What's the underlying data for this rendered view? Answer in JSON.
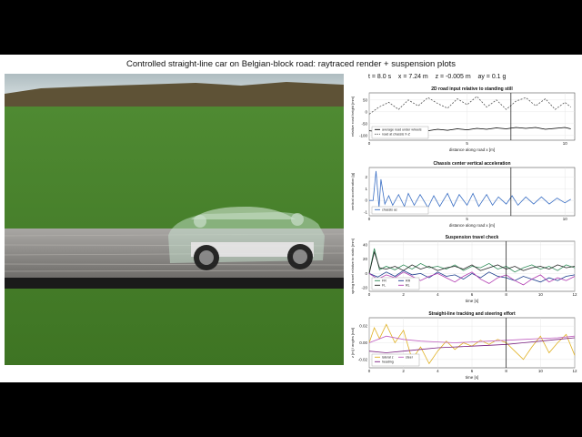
{
  "title": "Controlled straight-line car on Belgian-block road: raytraced render + suspension plots",
  "status": {
    "t": "t = 8.0 s",
    "x": "x = 7.24 m",
    "z": "z = -0.005 m",
    "ay": "ay = 0.1 g"
  },
  "colors": {
    "grass": "#3f7f24",
    "road": "#8a8a8a",
    "sky_top": "#c9d6d9",
    "car_body": "#b7d6c2"
  },
  "chart_data": [
    {
      "type": "line",
      "title": "2D road input relative to standing still",
      "xlabel": "distance along road x [m]",
      "ylabel": "relative road height [mm]",
      "xticks": [
        "0",
        "5",
        "10"
      ],
      "yticks": [
        "50",
        "0",
        "-50",
        "-100"
      ],
      "xlim": [
        0,
        10.5
      ],
      "ylim": [
        -120,
        80
      ],
      "legend_position": "bottom-left",
      "cursor_x": 7.24,
      "series": [
        {
          "name": "average road under wheels",
          "color": "#000000",
          "style": "solid",
          "x": [
            0,
            0.5,
            1,
            1.5,
            2,
            2.5,
            3,
            3.5,
            4,
            4.5,
            5,
            5.5,
            6,
            6.5,
            7,
            7.5,
            8,
            8.5,
            9,
            9.5,
            10,
            10.3
          ],
          "y": [
            -80,
            -84,
            -82,
            -78,
            -82,
            -76,
            -80,
            -74,
            -78,
            -72,
            -76,
            -70,
            -74,
            -68,
            -72,
            -66,
            -70,
            -66,
            -74,
            -70,
            -66,
            -72
          ]
        },
        {
          "name": "road at chassis X-Z",
          "color": "#555555",
          "style": "dashed",
          "x": [
            0,
            0.5,
            1,
            1.5,
            2,
            2.5,
            3,
            3.5,
            4,
            4.5,
            5,
            5.5,
            6,
            6.5,
            7,
            7.5,
            8,
            8.5,
            9,
            9.5,
            10,
            10.3
          ],
          "y": [
            -10,
            20,
            40,
            10,
            50,
            25,
            60,
            35,
            15,
            55,
            30,
            65,
            20,
            50,
            10,
            45,
            60,
            25,
            55,
            10,
            40,
            20
          ]
        }
      ]
    },
    {
      "type": "line",
      "title": "Chassis center vertical acceleration",
      "xlabel": "distance along road x [m]",
      "ylabel": "vertical acceleration [g]",
      "xticks": [
        "0",
        "5",
        "10"
      ],
      "yticks": [
        "2",
        "1",
        "0",
        "-1"
      ],
      "xlim": [
        0,
        10.5
      ],
      "ylim": [
        -1.3,
        2.8
      ],
      "legend_position": "bottom-left",
      "cursor_x": 7.24,
      "series": [
        {
          "name": "chassis az",
          "color": "#3a6fc4",
          "style": "solid",
          "x": [
            0,
            0.2,
            0.35,
            0.5,
            0.6,
            0.8,
            1,
            1.2,
            1.5,
            1.8,
            2,
            2.3,
            2.6,
            3,
            3.3,
            3.6,
            4,
            4.3,
            4.6,
            5,
            5.3,
            5.6,
            6,
            6.3,
            6.6,
            7,
            7.3,
            7.6,
            8,
            8.4,
            8.8,
            9.2,
            9.6,
            10,
            10.3
          ],
          "y": [
            0,
            0,
            2.5,
            -0.6,
            1.8,
            -0.3,
            0.4,
            -0.4,
            0.5,
            -0.5,
            0.6,
            -0.4,
            0.5,
            -0.6,
            0.4,
            -0.5,
            0.6,
            -0.5,
            0.5,
            -0.4,
            0.6,
            -0.5,
            0.5,
            -0.4,
            0.3,
            -0.3,
            0.4,
            -0.4,
            0.3,
            -0.3,
            0.3,
            -0.3,
            0.2,
            -0.2,
            0.1
          ]
        }
      ]
    },
    {
      "type": "line",
      "title": "Suspension travel check",
      "xlabel": "time [s]",
      "ylabel": "spring travel relative to static [mm]",
      "xticks": [
        "0",
        "2",
        "4",
        "6",
        "8",
        "10",
        "12"
      ],
      "yticks": [
        "40",
        "20",
        "0",
        "-20"
      ],
      "xlim": [
        0,
        12
      ],
      "ylim": [
        -25,
        45
      ],
      "legend_position": "bottom-left",
      "cursor_x": 8,
      "series": [
        {
          "name": "FR",
          "color": "#2e8b57",
          "style": "solid",
          "x": [
            0,
            0.3,
            0.6,
            1,
            1.5,
            2,
            2.5,
            3,
            3.5,
            4,
            4.5,
            5,
            5.5,
            6,
            6.5,
            7,
            7.5,
            8,
            8.5,
            9,
            9.5,
            10,
            10.5,
            11,
            11.5,
            12
          ],
          "y": [
            0,
            35,
            5,
            10,
            5,
            12,
            6,
            14,
            8,
            10,
            6,
            12,
            4,
            10,
            8,
            14,
            6,
            10,
            2,
            8,
            12,
            6,
            10,
            4,
            12,
            8
          ]
        },
        {
          "name": "FL",
          "color": "#222222",
          "style": "solid",
          "x": [
            0,
            0.3,
            0.6,
            1,
            1.5,
            2,
            2.5,
            3,
            3.5,
            4,
            4.5,
            5,
            5.5,
            6,
            6.5,
            7,
            7.5,
            8,
            8.5,
            9,
            9.5,
            10,
            10.5,
            11,
            11.5,
            12
          ],
          "y": [
            0,
            30,
            8,
            6,
            10,
            4,
            12,
            6,
            10,
            4,
            8,
            10,
            6,
            12,
            4,
            8,
            12,
            6,
            10,
            4,
            8,
            10,
            6,
            12,
            8,
            10
          ]
        },
        {
          "name": "RR",
          "color": "#1a3c8c",
          "style": "solid",
          "x": [
            0,
            0.5,
            1,
            1.5,
            2,
            2.5,
            3,
            3.5,
            4,
            4.5,
            5,
            5.5,
            6,
            6.5,
            7,
            7.5,
            8,
            8.5,
            9,
            9.5,
            10,
            10.5,
            11,
            11.5,
            12
          ],
          "y": [
            0,
            -5,
            2,
            -4,
            4,
            -2,
            0,
            -6,
            2,
            -4,
            -2,
            -8,
            0,
            -6,
            2,
            -4,
            -6,
            -10,
            -4,
            -8,
            -12,
            -6,
            -10,
            -4,
            -2
          ]
        },
        {
          "name": "RL",
          "color": "#b03ab0",
          "style": "solid",
          "x": [
            0,
            0.5,
            1,
            1.5,
            2,
            2.5,
            3,
            3.5,
            4,
            4.5,
            5,
            5.5,
            6,
            6.5,
            7,
            7.5,
            8,
            8.5,
            9,
            9.5,
            10,
            10.5,
            11,
            11.5,
            12
          ],
          "y": [
            0,
            -8,
            -2,
            -6,
            2,
            -4,
            -10,
            -4,
            0,
            -6,
            -12,
            -4,
            2,
            -8,
            -14,
            -6,
            -2,
            -10,
            -16,
            -8,
            -2,
            -12,
            -6,
            -10,
            -4
          ]
        }
      ]
    },
    {
      "type": "line",
      "title": "Straight-line tracking and steering effort",
      "xlabel": "time [s]",
      "ylabel": "z [m] / angles [rad]",
      "xticks": [
        "0",
        "2",
        "4",
        "6",
        "8",
        "10",
        "12"
      ],
      "yticks": [
        "0.02",
        "0.00",
        "-0.02"
      ],
      "xlim": [
        0,
        12
      ],
      "ylim": [
        -0.03,
        0.03
      ],
      "legend_position": "bottom-left",
      "cursor_x": 8,
      "series": [
        {
          "name": "lateral z",
          "color": "#e0b020",
          "style": "solid",
          "x": [
            0,
            0.3,
            0.6,
            1,
            1.5,
            2,
            2.5,
            3,
            3.5,
            4,
            4.5,
            5,
            5.5,
            6,
            6.5,
            7,
            7.5,
            8,
            8.5,
            9,
            9.5,
            10,
            10.5,
            11,
            11.5,
            12
          ],
          "y": [
            0,
            0.018,
            0.005,
            0.022,
            0.0,
            0.015,
            -0.02,
            -0.005,
            -0.025,
            -0.01,
            0.002,
            -0.008,
            0.0,
            -0.004,
            0.003,
            -0.002,
            0.004,
            0.0,
            -0.01,
            -0.02,
            -0.005,
            0.008,
            -0.012,
            0.0,
            0.01,
            -0.015
          ]
        },
        {
          "name": "heading",
          "color": "#7a2080",
          "style": "solid",
          "x": [
            0,
            1,
            2,
            3,
            4,
            5,
            6,
            7,
            8,
            9,
            10,
            11,
            12
          ],
          "y": [
            -0.01,
            -0.012,
            -0.01,
            -0.008,
            -0.006,
            -0.005,
            -0.004,
            -0.003,
            -0.002,
            0.0,
            0.002,
            0.004,
            0.006
          ]
        },
        {
          "name": "steer",
          "color": "#c060c0",
          "style": "solid",
          "x": [
            0,
            1,
            2,
            3,
            4,
            5,
            6,
            7,
            8,
            9,
            10,
            11,
            12
          ],
          "y": [
            0,
            0.008,
            0.004,
            0.002,
            0.001,
            0.0,
            0.001,
            0.002,
            0.003,
            0.004,
            0.005,
            0.006,
            0.008
          ]
        }
      ]
    }
  ]
}
